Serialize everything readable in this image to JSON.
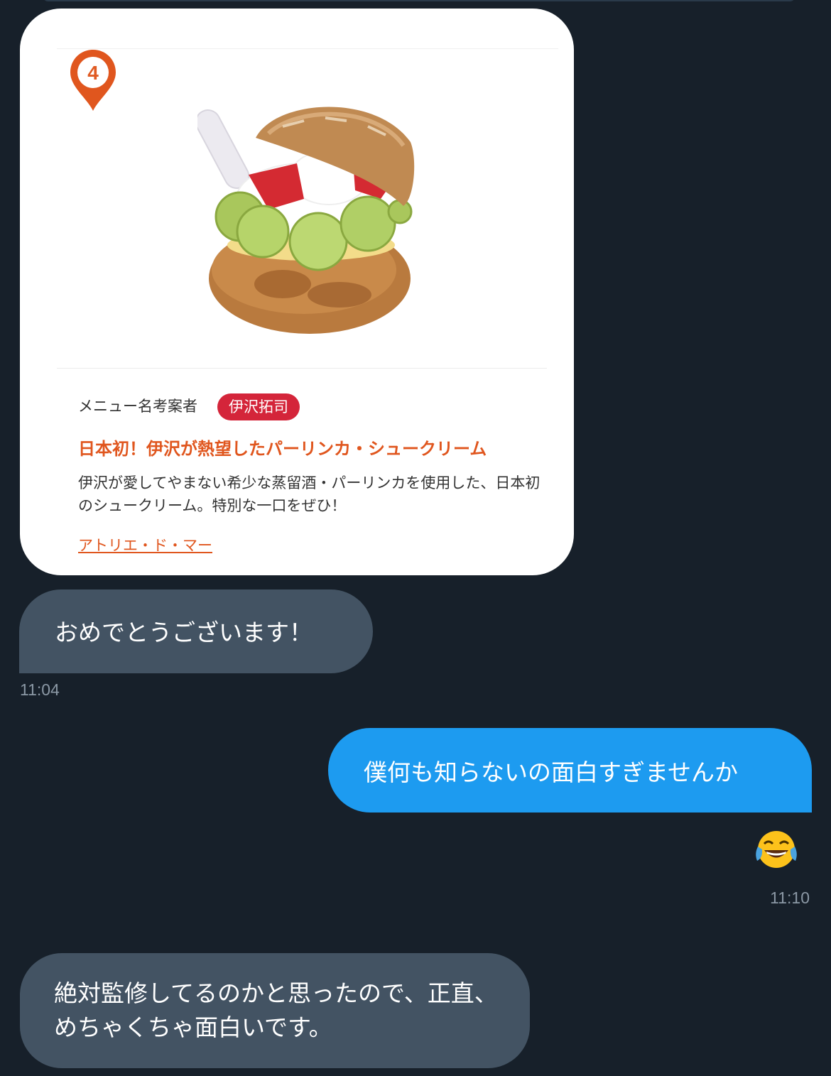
{
  "card": {
    "pin_number": "4",
    "proposer_label": "メニュー名考案者",
    "proposer_name": "伊沢拓司",
    "menu_title": "日本初！伊沢が熱望したパーリンカ・シュークリーム",
    "description": "伊沢が愛してやまない希少な蒸留酒・パーリンカを使用した、日本初のシュークリーム。特別な一口をぜひ！",
    "shop_link": "アトリエ・ド・マー"
  },
  "messages": [
    {
      "direction": "incoming",
      "text": "おめでとうございます！",
      "time": "11:04"
    },
    {
      "direction": "outgoing",
      "text": "僕何も知らないの面白すぎませんか",
      "emoji": "😂",
      "time": "11:10"
    },
    {
      "direction": "incoming",
      "text": "絶対監修してるのかと思ったので、正直、めちゃくちゃ面白いです。"
    }
  ],
  "colors": {
    "background": "#17202a",
    "incoming_bubble": "#435363",
    "outgoing_bubble": "#1d9bf0",
    "accent_orange": "#e0561e",
    "badge_red": "#d4253a"
  },
  "icons": [
    "map-pin-icon",
    "cream-puff-image",
    "face-with-tears-of-joy-emoji"
  ]
}
